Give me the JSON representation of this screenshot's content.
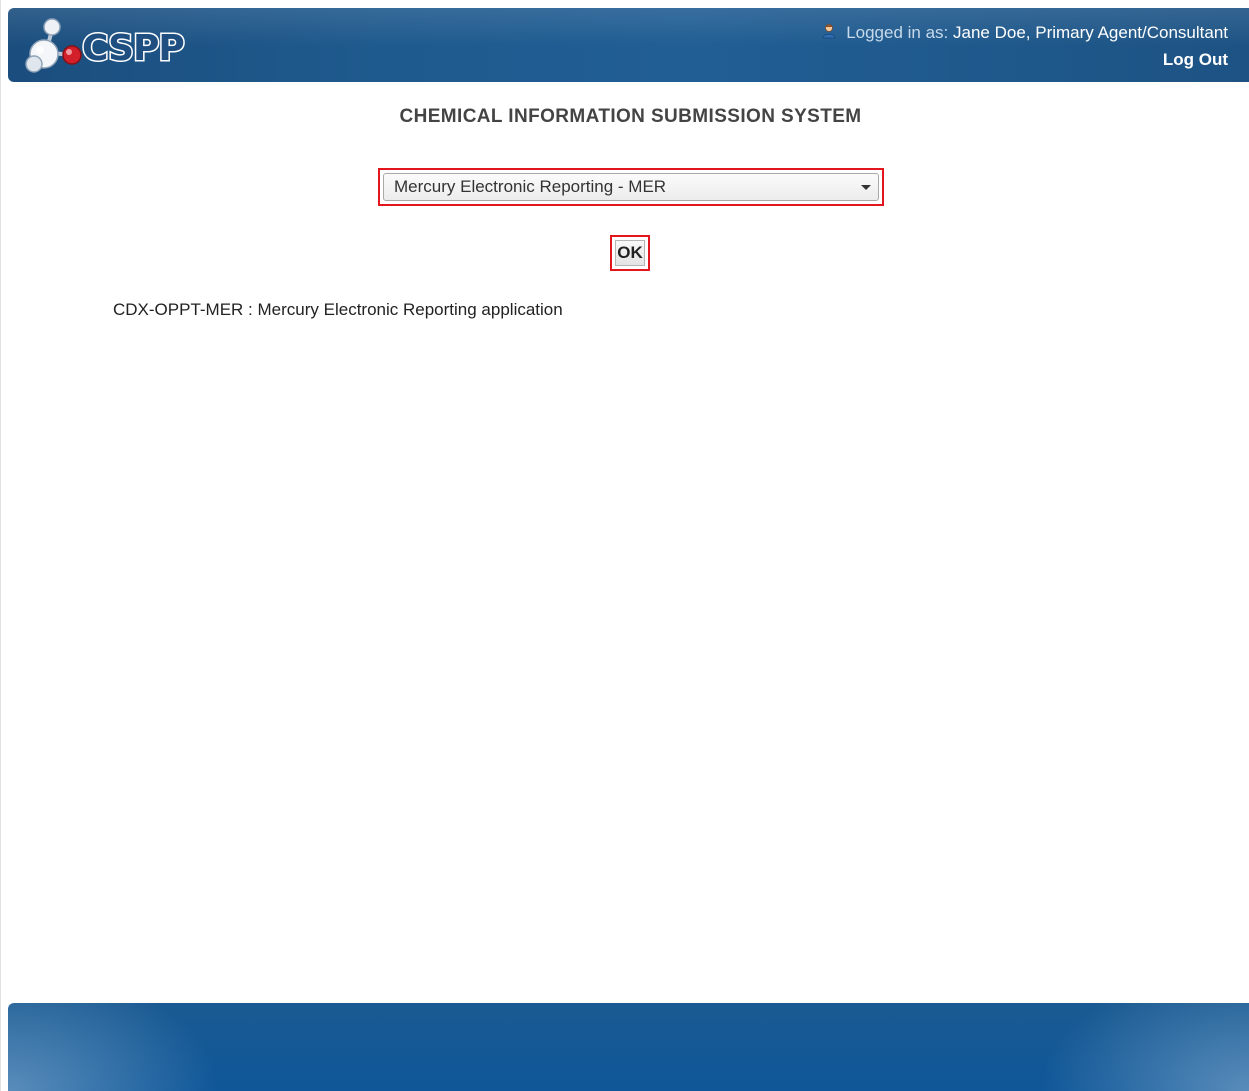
{
  "header": {
    "logo_text": "CSPP",
    "logged_in_prefix": "Logged in as:",
    "user": "Jane Doe, Primary Agent/Consultant",
    "logout_label": "Log Out"
  },
  "main": {
    "title": "CHEMICAL INFORMATION SUBMISSION SYSTEM",
    "select": {
      "selected": "Mercury Electronic Reporting - MER"
    },
    "ok_label": "OK",
    "description": "CDX-OPPT-MER : Mercury Electronic Reporting application"
  },
  "icons": {
    "logo": "molecule-logo-icon",
    "user": "user-icon",
    "dropdown": "chevron-down-icon"
  },
  "colors": {
    "header_blue": "#1f5a8e",
    "footer_blue": "#0f5799",
    "highlight_red": "#e3161d"
  }
}
